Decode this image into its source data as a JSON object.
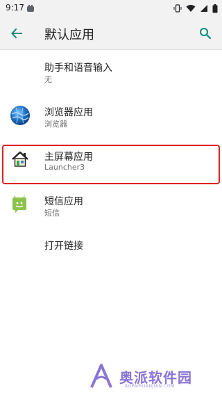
{
  "status_bar": {
    "time": "9:17"
  },
  "app_bar": {
    "title": "默认应用",
    "back_icon": "arrow-back-icon",
    "search_icon": "search-icon"
  },
  "items": [
    {
      "title": "助手和语音输入",
      "summary": "无",
      "icon": ""
    },
    {
      "title": "浏览器应用",
      "summary": "浏览器",
      "icon": "browser-globe-icon"
    },
    {
      "title": "主屏幕应用",
      "summary": "Launcher3",
      "icon": "launcher-house-icon"
    },
    {
      "title": "短信应用",
      "summary": "短信",
      "icon": "sms-android-icon"
    },
    {
      "title": "打开链接",
      "summary": "",
      "icon": ""
    }
  ],
  "watermark": {
    "text": "奥派软件园",
    "sub": "AOPAIRUANJIAN.COM"
  },
  "colors": {
    "accent": "#00897b",
    "highlight": "#e02020",
    "watermark": "#8b74d6"
  }
}
